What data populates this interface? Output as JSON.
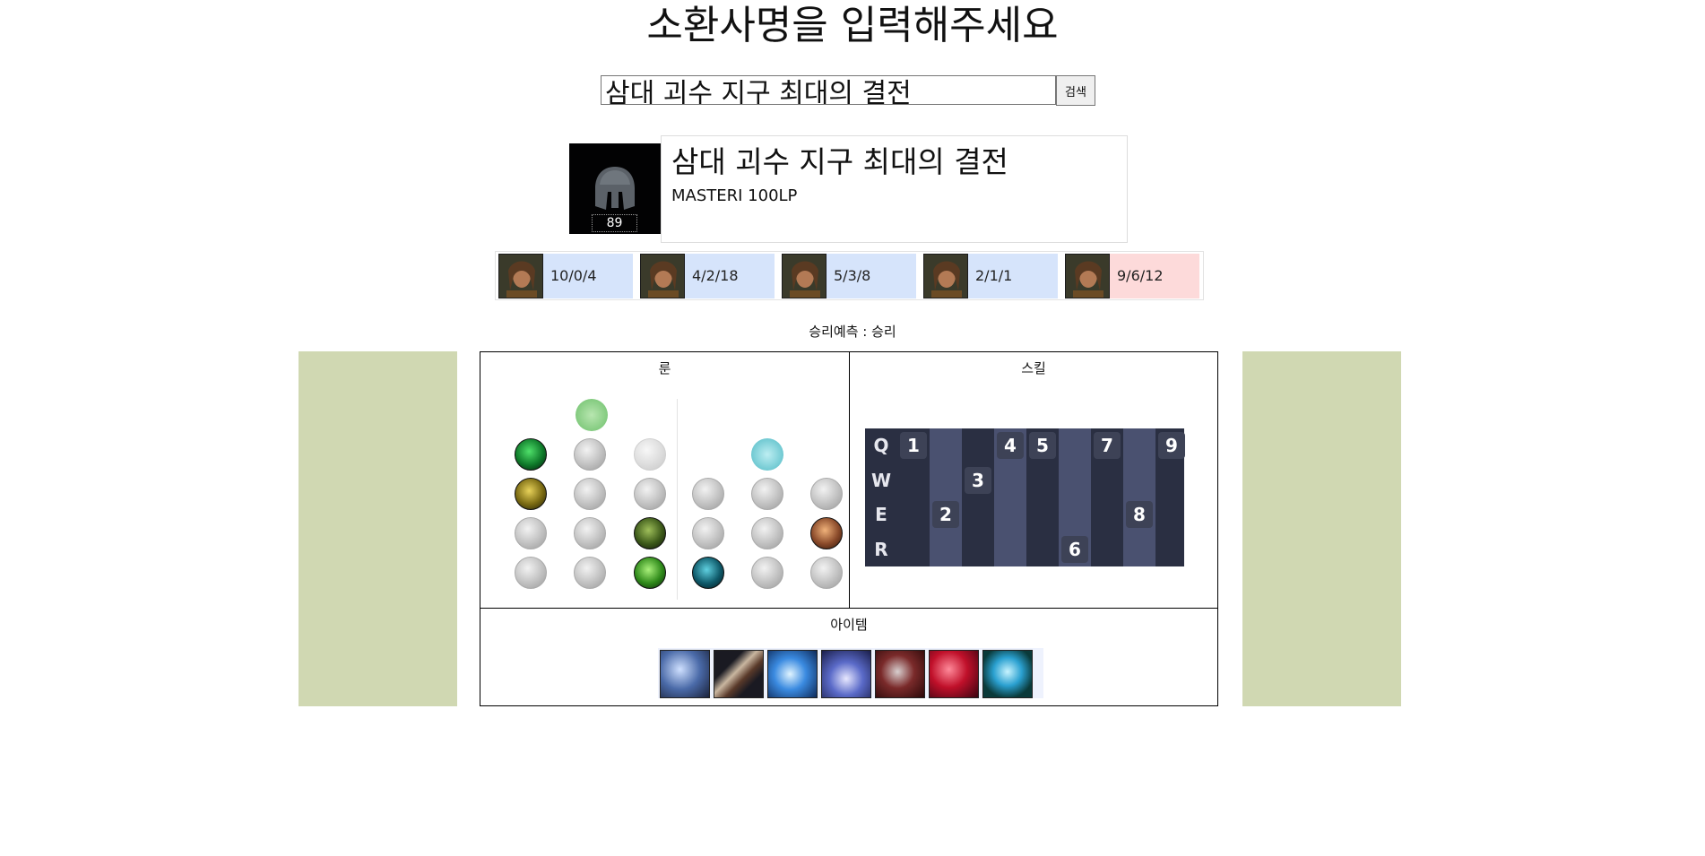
{
  "header": {
    "title": "소환사명을 입력해주세요"
  },
  "search": {
    "value": "삼대 괴수 지구 최대의 결전",
    "button_label": "검색"
  },
  "profile": {
    "icon": "spartan-helmet-icon",
    "level": "89",
    "name": "삼대 괴수 지구 최대의 결전",
    "rank": "MASTERI 100LP"
  },
  "matches": [
    {
      "champion_icon": "champion-portrait-icon",
      "kda": "10/0/4",
      "result": "win"
    },
    {
      "champion_icon": "champion-portrait-icon",
      "kda": "4/2/18",
      "result": "win"
    },
    {
      "champion_icon": "champion-portrait-icon",
      "kda": "5/3/8",
      "result": "win"
    },
    {
      "champion_icon": "champion-portrait-icon",
      "kda": "2/1/1",
      "result": "win"
    },
    {
      "champion_icon": "champion-portrait-icon",
      "kda": "9/6/12",
      "result": "loss"
    }
  ],
  "prediction": {
    "text": "승리예측 : 승리"
  },
  "runes": {
    "title": "룬",
    "primary_tree_icon": "resolve-tree-icon",
    "secondary_tree_icon": "sorcery-tree-icon"
  },
  "skills": {
    "title": "스킬",
    "rows": [
      "Q",
      "W",
      "E",
      "R"
    ],
    "order": [
      {
        "level": "1",
        "skill": "Q"
      },
      {
        "level": "2",
        "skill": "E"
      },
      {
        "level": "3",
        "skill": "W"
      },
      {
        "level": "4",
        "skill": "Q"
      },
      {
        "level": "5",
        "skill": "Q"
      },
      {
        "level": "6",
        "skill": "R"
      },
      {
        "level": "7",
        "skill": "Q"
      },
      {
        "level": "8",
        "skill": "E"
      },
      {
        "level": "9",
        "skill": "Q"
      }
    ]
  },
  "items": {
    "title": "아이템",
    "list": [
      "frost-armor-item-icon",
      "dark-sword-item-icon",
      "ice-crystal-item-icon",
      "spiked-boots-item-icon",
      "red-gauntlet-item-icon",
      "ruby-crystal-item-icon",
      "blue-orb-item-icon"
    ]
  },
  "colors": {
    "win_bg": "#d6e4fb",
    "loss_bg": "#fddada",
    "side_panel": "#d0d8b2",
    "skill_table_bg": "#2a2f42",
    "skill_stripe": "#4a5170"
  }
}
